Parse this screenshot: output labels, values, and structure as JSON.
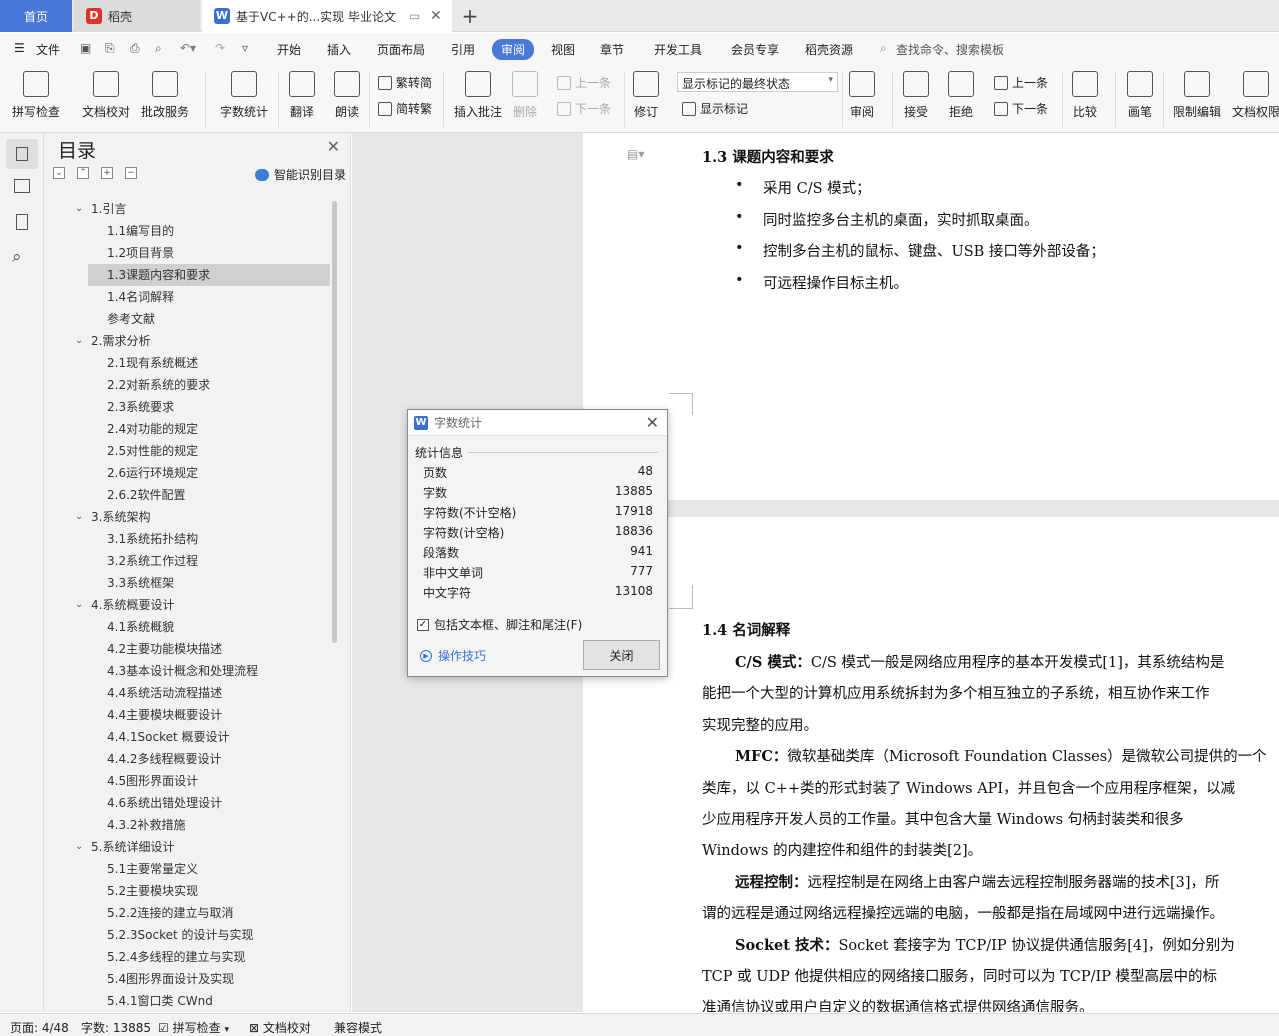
{
  "tabs": {
    "home": "首页",
    "daoke": "稻壳",
    "doc": "基于VC++的...实现 毕业论文"
  },
  "menu": {
    "file": "文件",
    "items": [
      "开始",
      "插入",
      "页面布局",
      "引用",
      "审阅",
      "视图",
      "章节",
      "开发工具",
      "会员专享",
      "稻壳资源"
    ],
    "active": "审阅",
    "search": "查找命令、搜索模板"
  },
  "ribbon": {
    "spell": "拼写检查",
    "proof": "文档校对",
    "batch": "批改服务",
    "wordcount": "字数统计",
    "translate": "翻译",
    "read": "朗读",
    "t2s": "繁转简",
    "s2t": "简转繁",
    "insert_comment": "插入批注",
    "delete": "删除",
    "prev_c": "上一条",
    "next_c": "下一条",
    "revise": "修订",
    "markup_select": "显示标记的最终状态",
    "show_markup": "显示标记",
    "review": "审阅",
    "accept": "接受",
    "reject": "拒绝",
    "prev": "上一条",
    "next": "下一条",
    "compare": "比较",
    "pen": "画笔",
    "restrict": "限制编辑",
    "perm": "文档权限"
  },
  "toc": {
    "title": "目录",
    "smart": "智能识别目录",
    "items": [
      {
        "label": "1.引言",
        "level": 1
      },
      {
        "label": "1.1编写目的",
        "level": 2
      },
      {
        "label": "1.2项目背景",
        "level": 2
      },
      {
        "label": "1.3课题内容和要求",
        "level": 2,
        "selected": true
      },
      {
        "label": "1.4名词解释",
        "level": 2
      },
      {
        "label": "参考文献",
        "level": 2
      },
      {
        "label": "2.需求分析",
        "level": 1
      },
      {
        "label": "2.1现有系统概述",
        "level": 2
      },
      {
        "label": "2.2对新系统的要求",
        "level": 2
      },
      {
        "label": "2.3系统要求",
        "level": 2
      },
      {
        "label": "2.4对功能的规定",
        "level": 2
      },
      {
        "label": "2.5对性能的规定",
        "level": 2
      },
      {
        "label": "2.6运行环境规定",
        "level": 2
      },
      {
        "label": "2.6.2软件配置",
        "level": 2
      },
      {
        "label": "3.系统架构",
        "level": 1
      },
      {
        "label": "3.1系统拓扑结构",
        "level": 2
      },
      {
        "label": "3.2系统工作过程",
        "level": 2
      },
      {
        "label": "3.3系统框架",
        "level": 2
      },
      {
        "label": "4.系统概要设计",
        "level": 1
      },
      {
        "label": "4.1系统概貌",
        "level": 2
      },
      {
        "label": "4.2主要功能模块描述",
        "level": 2
      },
      {
        "label": "4.3基本设计概念和处理流程",
        "level": 2
      },
      {
        "label": "4.4系统活动流程描述",
        "level": 2
      },
      {
        "label": "4.4主要模块概要设计",
        "level": 2
      },
      {
        "label": "4.4.1Socket 概要设计",
        "level": 2
      },
      {
        "label": "4.4.2多线程概要设计",
        "level": 2
      },
      {
        "label": "4.5图形界面设计",
        "level": 2
      },
      {
        "label": "4.6系统出错处理设计",
        "level": 2
      },
      {
        "label": "4.3.2补救措施",
        "level": 2
      },
      {
        "label": "5.系统详细设计",
        "level": 1
      },
      {
        "label": "5.1主要常量定义",
        "level": 2
      },
      {
        "label": "5.2主要模块实现",
        "level": 2
      },
      {
        "label": "5.2.2连接的建立与取消",
        "level": 2
      },
      {
        "label": "5.2.3Socket 的设计与实现",
        "level": 2
      },
      {
        "label": "5.2.4多线程的建立与实现",
        "level": 2
      },
      {
        "label": "5.4图形界面设计及实现",
        "level": 2
      },
      {
        "label": "5.4.1窗口类 CWnd",
        "level": 2
      }
    ]
  },
  "doc": {
    "h13": "1.3  课题内容和要求",
    "bullets": [
      "采用 C/S 模式；",
      "同时监控多台主机的桌面，实时抓取桌面。",
      "控制多台主机的鼠标、键盘、USB 接口等外部设备；",
      "可远程操作目标主机。"
    ],
    "h14": "1.4  名词解释",
    "lines": [
      {
        "b": "C/S 模式：",
        "t": "C/S 模式一般是网络应用程序的基本开发模式[1]，其系统结构是"
      },
      {
        "b": "",
        "t": "能把一个大型的计算机应用系统拆封为多个相互独立的子系统，相互协作来工作"
      },
      {
        "b": "",
        "t": "实现完整的应用。"
      },
      {
        "b": "MFC：",
        "t": "微软基础类库（Microsoft Foundation Classes）是微软公司提供的一个"
      },
      {
        "b": "",
        "t": "类库，以 C++类的形式封装了 Windows API，并且包含一个应用程序框架，以减"
      },
      {
        "b": "",
        "t": "少应用程序开发人员的工作量。其中包含大量  Windows 句柄封装类和很多"
      },
      {
        "b": "",
        "t": "Windows 的内建控件和组件的封装类[2]。"
      },
      {
        "b": "远程控制：",
        "t": "远程控制是在网络上由客户端去远程控制服务器端的技术[3]，所"
      },
      {
        "b": "",
        "t": "谓的远程是通过网络远程操控远端的电脑，一般都是指在局域网中进行远端操作。"
      },
      {
        "b": "Socket 技术：",
        "t": "Socket 套接字为  TCP/IP 协议提供通信服务[4]，例如分别为"
      },
      {
        "b": "",
        "t": "TCP 或  UDP 他提供相应的网络接口服务，同时可以为  TCP/IP 模型高层中的标"
      },
      {
        "b": "",
        "t": "准通信协议或用户自定义的数据通信格式提供网络通信服务。"
      }
    ]
  },
  "dialog": {
    "title": "字数统计",
    "section": "统计信息",
    "rows": [
      {
        "k": "页数",
        "v": "48"
      },
      {
        "k": "字数",
        "v": "13885"
      },
      {
        "k": "字符数(不计空格)",
        "v": "17918"
      },
      {
        "k": "字符数(计空格)",
        "v": "18836"
      },
      {
        "k": "段落数",
        "v": "941"
      },
      {
        "k": "非中文单词",
        "v": "777"
      },
      {
        "k": "中文字符",
        "v": "13108"
      }
    ],
    "checkbox": "包括文本框、脚注和尾注(F)",
    "checked": true,
    "tips": "操作技巧",
    "close": "关闭"
  },
  "status": {
    "page": "页面: 4/48",
    "words": "字数: 13885",
    "spell": "拼写检查",
    "proof": "文档校对",
    "compat": "兼容模式"
  },
  "colors": {
    "accent": "#4a78d8",
    "link": "#3b6fd6"
  }
}
